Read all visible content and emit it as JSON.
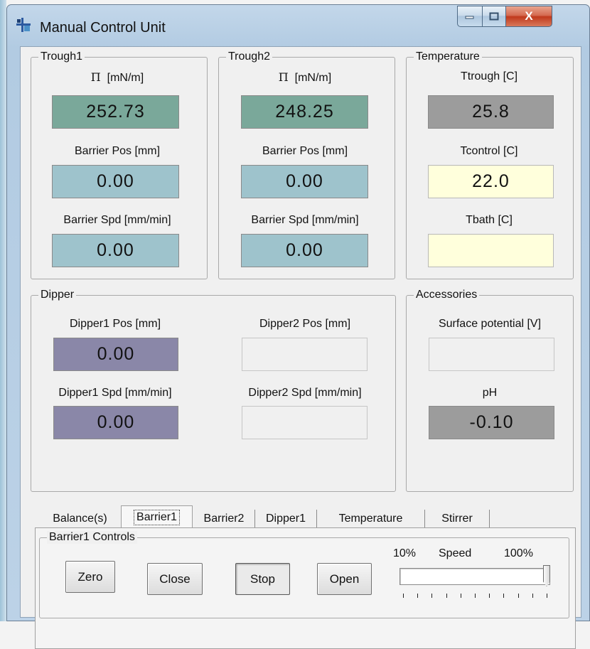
{
  "window": {
    "title": "Manual Control Unit",
    "close_glyph": "X",
    "icons": [
      "app-icon",
      "minimize-icon",
      "maximize-icon",
      "close-icon"
    ]
  },
  "trough1": {
    "legend": "Trough1",
    "pi_symbol": "Π",
    "pi_unit": "[mN/m]",
    "pi_value": "252.73",
    "barrier_pos_label": "Barrier Pos [mm]",
    "barrier_pos_value": "0.00",
    "barrier_spd_label": "Barrier Spd [mm/min]",
    "barrier_spd_value": "0.00"
  },
  "trough2": {
    "legend": "Trough2",
    "pi_symbol": "Π",
    "pi_unit": "[mN/m]",
    "pi_value": "248.25",
    "barrier_pos_label": "Barrier Pos [mm]",
    "barrier_pos_value": "0.00",
    "barrier_spd_label": "Barrier Spd [mm/min]",
    "barrier_spd_value": "0.00"
  },
  "temperature": {
    "legend": "Temperature",
    "ttrough_label": "Ttrough [C]",
    "ttrough_value": "25.8",
    "tcontrol_label": "Tcontrol [C]",
    "tcontrol_value": "22.0",
    "tbath_label": "Tbath [C]",
    "tbath_value": ""
  },
  "dipper": {
    "legend": "Dipper",
    "d1_pos_label": "Dipper1 Pos [mm]",
    "d1_pos_value": "0.00",
    "d2_pos_label": "Dipper2 Pos [mm]",
    "d2_pos_value": "",
    "d1_spd_label": "Dipper1 Spd [mm/min]",
    "d1_spd_value": "0.00",
    "d2_spd_label": "Dipper2 Spd [mm/min]",
    "d2_spd_value": ""
  },
  "accessories": {
    "legend": "Accessories",
    "surface_label": "Surface potential [V]",
    "surface_value": "",
    "ph_label": "pH",
    "ph_value": "-0.10"
  },
  "tabs": {
    "items": [
      "Balance(s)",
      "Barrier1",
      "Barrier2",
      "Dipper1",
      "Temperature",
      "Stirrer"
    ],
    "active": "Barrier1"
  },
  "barrier_controls": {
    "legend": "Barrier1 Controls",
    "zero": "Zero",
    "close": "Close",
    "stop": "Stop",
    "open": "Open",
    "speed_min": "10%",
    "speed_label": "Speed",
    "speed_max": "100%",
    "speed_fraction": 1.0
  },
  "colors": {
    "pressure_box": "#7aa89a",
    "barrier_box": "#9ec3cc",
    "readonly_gray_box": "#9c9c9c",
    "setpoint_yellow_box": "#ffffdc",
    "dipper_box": "#8a87a8",
    "close_button": "#c0391c"
  }
}
